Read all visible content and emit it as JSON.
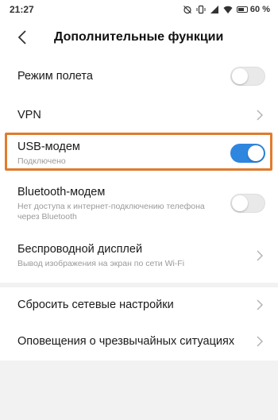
{
  "status_bar": {
    "time": "21:27",
    "battery_percent": "60 %",
    "icons": [
      "alarm-off-icon",
      "vibrate-icon",
      "signal-icon",
      "wifi-icon",
      "battery-icon"
    ]
  },
  "header": {
    "back_icon": "chevron-left-icon",
    "title": "Дополнительные функции"
  },
  "settings": {
    "airplane": {
      "label": "Режим полета",
      "toggle_on": false
    },
    "vpn": {
      "label": "VPN"
    },
    "usb_modem": {
      "label": "USB-модем",
      "status": "Подключено",
      "toggle_on": true
    },
    "bluetooth_modem": {
      "label": "Bluetooth-модем",
      "description": "Нет доступа к интернет-подключению телефона через Bluetooth",
      "toggle_on": false
    },
    "wireless_display": {
      "label": "Беспроводной дисплей",
      "description": "Вывод изображения на экран по сети Wi-Fi"
    },
    "reset_network": {
      "label": "Сбросить сетевые настройки"
    },
    "emergency_alerts": {
      "label": "Оповещения о чрезвычайных ситуациях"
    }
  },
  "colors": {
    "accent": "#2e86de",
    "highlight": "#e07b2c",
    "background": "#f2f2f2"
  }
}
